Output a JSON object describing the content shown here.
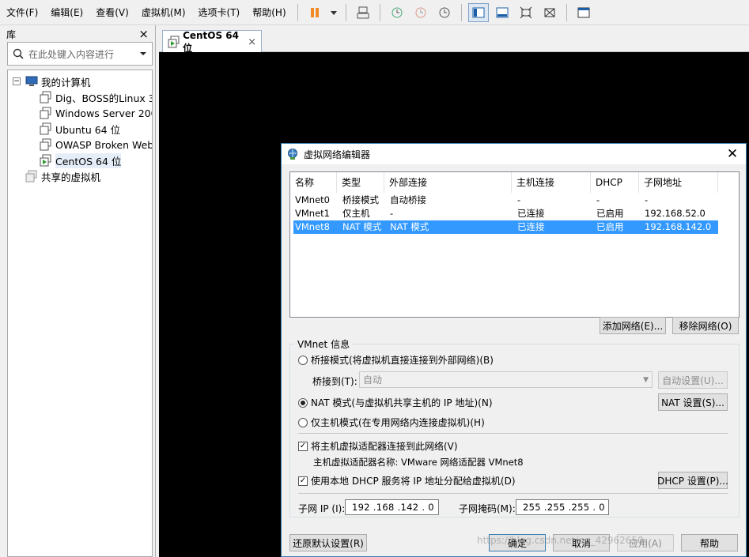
{
  "menu": {
    "file": "文件(F)",
    "edit": "编辑(E)",
    "view": "查看(V)",
    "vm": "虚拟机(M)",
    "tabs": "选项卡(T)",
    "help": "帮助(H)"
  },
  "toolbar": {
    "icons": [
      "pause-icon",
      "dropdown-arrow-icon",
      "send-ctrl-alt-del-icon",
      "snapshot-take-icon",
      "snapshot-revert-icon",
      "snapshot-manager-icon",
      "library-view-icon",
      "thumbnail-bar-icon",
      "fullscreen-icon",
      "unity-icon",
      "console-view-icon"
    ]
  },
  "library": {
    "title": "库",
    "close": "×",
    "search_placeholder": "在此处键入内容进行",
    "tree": {
      "root_label": "我的计算机",
      "root_expander": "⊟",
      "vms": [
        {
          "label": "Dig、BOSS的Linux 3."
        },
        {
          "label": "Windows Server 200"
        },
        {
          "label": "Ubuntu 64 位"
        },
        {
          "label": "OWASP Broken Web"
        },
        {
          "label": "CentOS 64 位"
        }
      ],
      "shared_label": "共享的虚拟机"
    }
  },
  "tab": {
    "label": "CentOS 64 位",
    "close": "×"
  },
  "dialog": {
    "title": "虚拟网络编辑器",
    "close": "✕",
    "columns": [
      "名称",
      "类型",
      "外部连接",
      "主机连接",
      "DHCP",
      "子网地址"
    ],
    "rows": [
      [
        "VMnet0",
        "桥接模式",
        "自动桥接",
        "-",
        "-",
        "-"
      ],
      [
        "VMnet1",
        "仅主机",
        "-",
        "已连接",
        "已启用",
        "192.168.52.0"
      ],
      [
        "VMnet8",
        "NAT 模式",
        "NAT 模式",
        "已连接",
        "已启用",
        "192.168.142.0"
      ]
    ],
    "add_network": "添加网络(E)...",
    "remove_network": "移除网络(O)",
    "group_label": "VMnet 信息",
    "bridged_radio": "桥接模式(将虚拟机直接连接到外部网络)(B)",
    "bridged_to_label": "桥接到(T):",
    "bridged_to_value": "自动",
    "auto_settings": "自动设置(U)...",
    "nat_radio": "NAT 模式(与虚拟机共享主机的 IP 地址)(N)",
    "nat_settings": "NAT 设置(S)...",
    "hostonly_radio": "仅主机模式(在专用网络内连接虚拟机)(H)",
    "connect_adapter": "将主机虚拟适配器连接到此网络(V)",
    "adapter_name": "主机虚拟适配器名称: VMware 网络适配器 VMnet8",
    "use_dhcp": "使用本地 DHCP 服务将 IP 地址分配给虚拟机(D)",
    "dhcp_settings": "DHCP 设置(P)...",
    "subnet_ip_label": "子网 IP (I):",
    "subnet_ip_value": "192 .168 .142 . 0",
    "subnet_mask_label": "子网掩码(M):",
    "subnet_mask_value": "255 .255 .255 . 0",
    "restore_defaults": "还原默认设置(R)",
    "ok": "确定",
    "cancel": "取消",
    "apply": "应用(A)",
    "help": "帮助"
  },
  "watermark": "https://blog.csdn.net/qq_42962650",
  "colors": {
    "selection": "#3399ff",
    "console": "#000000",
    "accent_border": "#3c7fb1"
  }
}
